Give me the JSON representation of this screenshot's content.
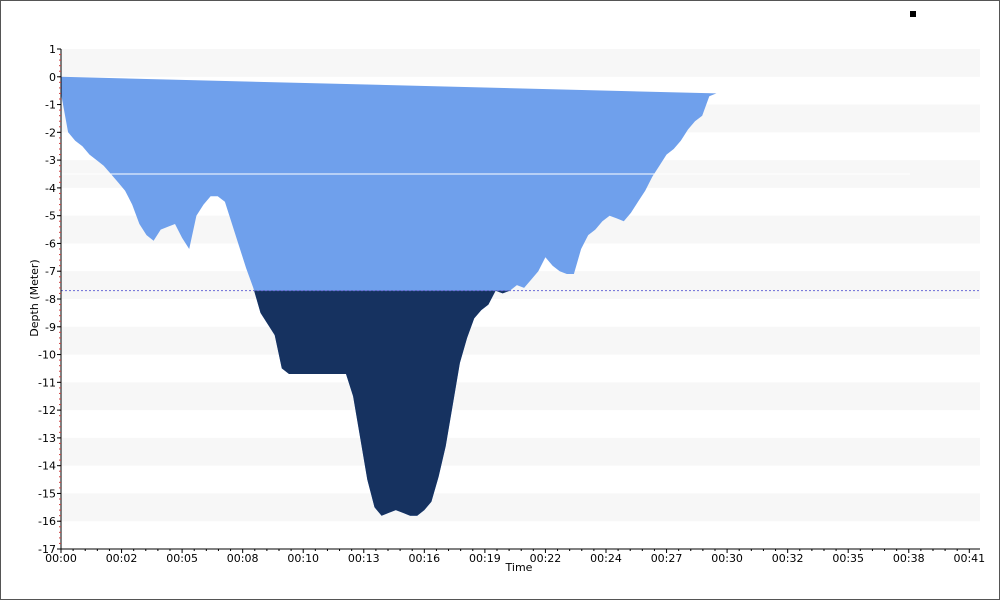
{
  "chart_data": {
    "type": "area",
    "title": "",
    "xlabel": "Time",
    "ylabel": "Depth (Meter)",
    "x_ticks": [
      "00:00",
      "00:02",
      "00:05",
      "00:08",
      "00:10",
      "00:13",
      "00:16",
      "00:19",
      "00:22",
      "00:24",
      "00:27",
      "00:30",
      "00:32",
      "00:35",
      "00:38",
      "00:41"
    ],
    "xlim_seconds": [
      0,
      2580
    ],
    "ylim": [
      -17,
      1
    ],
    "y_ticks": [
      1,
      0,
      -1,
      -2,
      -3,
      -4,
      -5,
      -6,
      -7,
      -8,
      -9,
      -10,
      -11,
      -12,
      -13,
      -14,
      -15,
      -16,
      -17
    ],
    "threshold_line_depth": -3.5,
    "dashed_line_depth": -7.7,
    "shallow_fill_color": "#6fa0ec",
    "deep_fill_color": "#163260",
    "band_color": "#f7f7f7",
    "grid": false,
    "series": [
      {
        "x_seconds": [
          0,
          20,
          40,
          60,
          80,
          100,
          120,
          140,
          160,
          180,
          200,
          220,
          240,
          260,
          280,
          300,
          320,
          340,
          360,
          380,
          400,
          420,
          440,
          460,
          480,
          500,
          520,
          540,
          560,
          580,
          600,
          620,
          640,
          660,
          680,
          700,
          720,
          740,
          760,
          780,
          800,
          820,
          840,
          860,
          880,
          900,
          920,
          940,
          960,
          980,
          1000,
          1020,
          1040,
          1060,
          1080,
          1100,
          1120,
          1140,
          1160,
          1180,
          1200,
          1220,
          1240,
          1260,
          1280,
          1300,
          1320,
          1340,
          1360,
          1380,
          1400,
          1420,
          1440,
          1460,
          1480,
          1500,
          1520,
          1540,
          1560,
          1580,
          1600,
          1620,
          1640,
          1660,
          1680,
          1700,
          1720,
          1740,
          1760,
          1780,
          1800,
          1820,
          1840,
          1860,
          1880,
          1900,
          1920,
          1940,
          1960,
          1980,
          2000,
          2020,
          2040,
          2060,
          2080,
          2100,
          2120,
          2140,
          2160,
          2180,
          2200,
          2220,
          2240,
          2260,
          2280,
          2300,
          2320,
          2340,
          2360,
          2380,
          2400,
          2420,
          2440,
          2460,
          2480,
          2500,
          2520,
          2540,
          2560,
          2580
        ],
        "y": [
          -0.6,
          -2.0,
          -2.3,
          -2.5,
          -2.8,
          -3.0,
          -3.2,
          -3.5,
          -3.8,
          -4.1,
          -4.6,
          -5.3,
          -5.7,
          -5.9,
          -5.5,
          -5.4,
          -5.3,
          -5.8,
          -6.2,
          -5.0,
          -4.6,
          -4.3,
          -4.3,
          -4.5,
          -5.3,
          -6.1,
          -6.9,
          -7.6,
          -8.5,
          -8.9,
          -9.3,
          -10.5,
          -10.7,
          -10.7,
          -10.7,
          -10.7,
          -10.7,
          -10.7,
          -10.7,
          -10.7,
          -10.7,
          -11.5,
          -13.0,
          -14.5,
          -15.5,
          -15.8,
          -15.7,
          -15.6,
          -15.7,
          -15.8,
          -15.8,
          -15.6,
          -15.3,
          -14.4,
          -13.3,
          -11.8,
          -10.3,
          -9.4,
          -8.7,
          -8.4,
          -8.2,
          -7.7,
          -7.8,
          -7.7,
          -7.5,
          -7.6,
          -7.3,
          -7.0,
          -6.5,
          -6.8,
          -7.0,
          -7.1,
          -7.1,
          -6.2,
          -5.7,
          -5.5,
          -5.2,
          -5.0,
          -5.1,
          -5.2,
          -4.9,
          -4.5,
          -4.1,
          -3.6,
          -3.2,
          -2.8,
          -2.6,
          -2.3,
          -1.9,
          -1.6,
          -1.4,
          -0.7,
          -0.6
        ]
      }
    ]
  }
}
